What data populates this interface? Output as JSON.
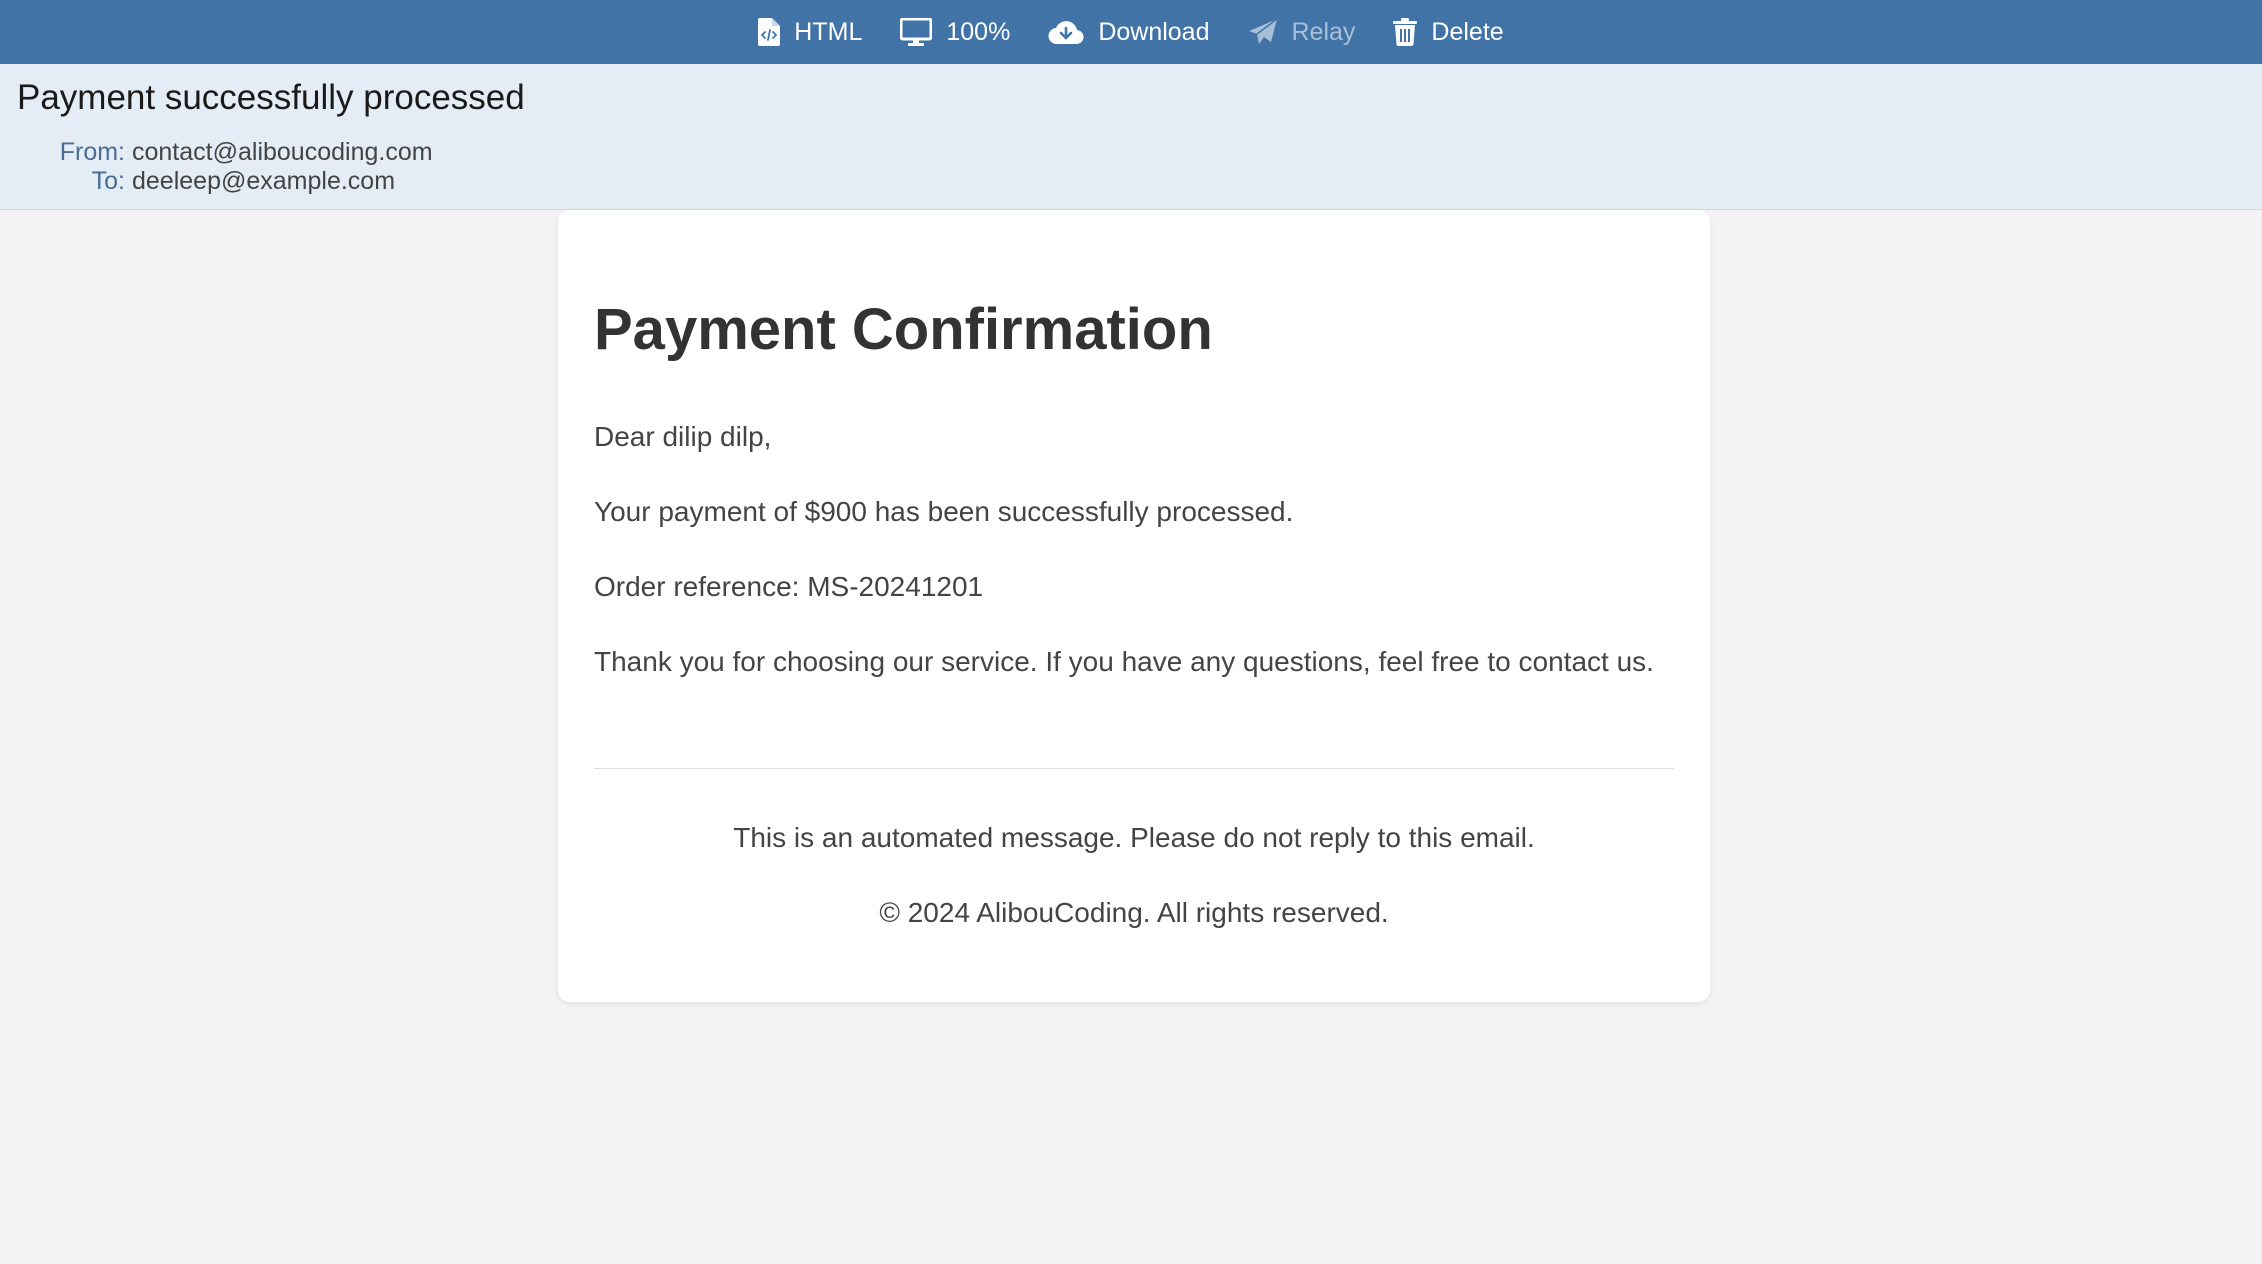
{
  "toolbar": {
    "items": [
      {
        "label": "HTML",
        "icon": "file-code-icon",
        "enabled": true
      },
      {
        "label": "100%",
        "icon": "monitor-icon",
        "enabled": true
      },
      {
        "label": "Download",
        "icon": "cloud-download-icon",
        "enabled": true
      },
      {
        "label": "Relay",
        "icon": "paper-plane-icon",
        "enabled": false
      },
      {
        "label": "Delete",
        "icon": "trash-icon",
        "enabled": true
      }
    ]
  },
  "header": {
    "subject": "Payment successfully processed",
    "from_label": "From:",
    "from_value": "contact@aliboucoding.com",
    "to_label": "To:",
    "to_value": "deeleep@example.com"
  },
  "email": {
    "title": "Payment Confirmation",
    "greeting": "Dear dilip dilp,",
    "payment_line": "Your payment of $900 has been successfully processed.",
    "order_line": "Order reference: MS-20241201",
    "thanks_line": "Thank you for choosing our service. If you have any questions, feel free to contact us.",
    "automated_notice": "This is an automated message. Please do not reply to this email.",
    "copyright": "© 2024 AlibouCoding. All rights reserved."
  },
  "colors": {
    "toolbar_bg": "#4173a7",
    "header_bg": "#e4ecf6",
    "page_bg": "#f3f3f3",
    "disabled_text": "#a9bfd8"
  }
}
